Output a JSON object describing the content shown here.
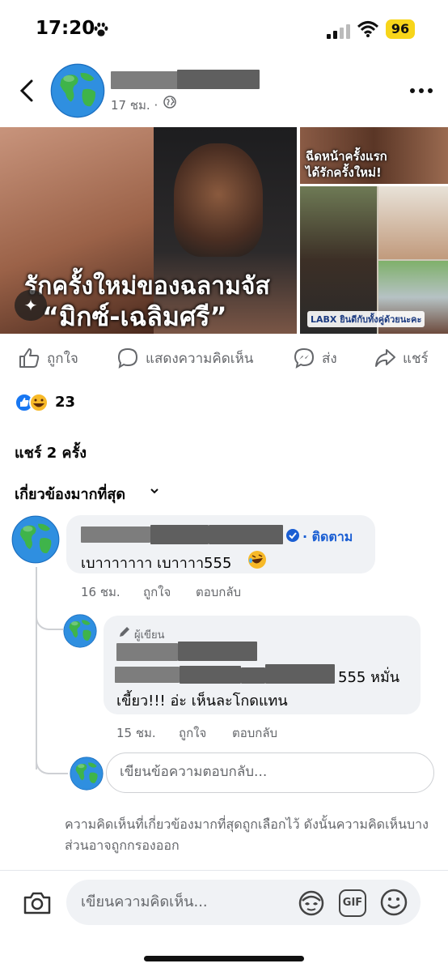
{
  "status_bar": {
    "time": "17:20",
    "battery": "96"
  },
  "post": {
    "time": "17 ชม. ·",
    "media": {
      "caption_line1": "รักครั้งใหม่ของฉลามจัส",
      "caption_line2": "“มิกซ์-เฉลิมศรี”",
      "side_caption_1": "ฉีดหน้าครั้งแรก",
      "side_caption_2": "ได้รักครั้งใหม่!",
      "side_caption_3": "LABX ยินดีกับทั้งคู่ด้วยนะคะ"
    },
    "actions": {
      "like": "ถูกใจ",
      "comment": "แสดงความคิดเห็น",
      "send": "ส่ง",
      "share": "แชร์"
    },
    "reaction_count": "23",
    "share_count": "แชร์ 2 ครั้ง",
    "sort_label": "เกี่ยวข้องมากที่สุด"
  },
  "comments": [
    {
      "follow_label": "· ติดตาม",
      "text": "เบาาาาาาา เบาาาา555",
      "time": "16 ชม.",
      "like_label": "ถูกใจ",
      "reply_label": "ตอบกลับ"
    },
    {
      "author_badge": "ผู้เขียน",
      "text_a": "555 หมั่น",
      "text_b": "เขี้ยว!!! อ่ะ เห็นละโกดแทน",
      "time": "15 ชม.",
      "like_label": "ถูกใจ",
      "reply_label": "ตอบกลับ"
    }
  ],
  "reply_placeholder": "เขียนข้อความตอบกลับ...",
  "filter_note": "ความคิดเห็นที่เกี่ยวข้องมากที่สุดถูกเลือกไว้ ดังนั้นความคิดเห็นบางส่วนอาจถูกกรองออก",
  "bottom_bar": {
    "placeholder": "เขียนความคิดเห็น...",
    "gif_label": "GIF"
  },
  "icons": [
    "paw-icon",
    "signal-icon",
    "wifi-icon",
    "back-icon",
    "globe-icon",
    "more-icon",
    "sparkle-icon",
    "like-icon",
    "comment-icon",
    "messenger-icon",
    "share-icon",
    "chevron-down-icon",
    "verified-icon",
    "laugh-emoji-icon",
    "pen-icon",
    "camera-icon",
    "avatar-sticker-icon",
    "gif-icon",
    "smile-icon"
  ],
  "colors": {
    "link_blue": "#1a5ed3",
    "bubble_bg": "#f0f2f5",
    "secondary_text": "#65676b",
    "battery": "#f7d51a"
  }
}
